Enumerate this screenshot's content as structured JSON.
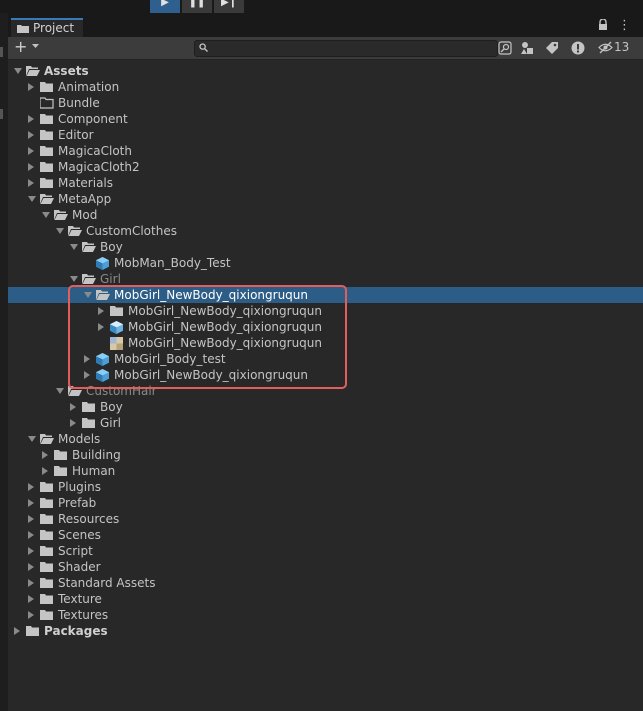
{
  "toolbar_top": {
    "play_icon": "play-icon",
    "pause_icon": "pause-icon",
    "step_icon": "step-icon"
  },
  "window": {
    "tab_label": "Project",
    "tab_icon": "folder-icon",
    "hidden_count": "13"
  },
  "tree": [
    {
      "label": "Assets",
      "depth": 0,
      "arrow": "down",
      "icon": "folder-open",
      "bold": true
    },
    {
      "label": "Animation",
      "depth": 1,
      "arrow": "right",
      "icon": "folder"
    },
    {
      "label": "Bundle",
      "depth": 1,
      "arrow": "none",
      "icon": "folder-empty"
    },
    {
      "label": "Component",
      "depth": 1,
      "arrow": "right",
      "icon": "folder"
    },
    {
      "label": "Editor",
      "depth": 1,
      "arrow": "right",
      "icon": "folder"
    },
    {
      "label": "MagicaCloth",
      "depth": 1,
      "arrow": "right",
      "icon": "folder"
    },
    {
      "label": "MagicaCloth2",
      "depth": 1,
      "arrow": "right",
      "icon": "folder"
    },
    {
      "label": "Materials",
      "depth": 1,
      "arrow": "right",
      "icon": "folder"
    },
    {
      "label": "MetaApp",
      "depth": 1,
      "arrow": "down",
      "icon": "folder-open"
    },
    {
      "label": "Mod",
      "depth": 2,
      "arrow": "down",
      "icon": "folder-open"
    },
    {
      "label": "CustomClothes",
      "depth": 3,
      "arrow": "down",
      "icon": "folder-open"
    },
    {
      "label": "Boy",
      "depth": 4,
      "arrow": "down",
      "icon": "folder-open"
    },
    {
      "label": "MobMan_Body_Test",
      "depth": 5,
      "arrow": "none",
      "icon": "prefab"
    },
    {
      "label": "Girl",
      "depth": 4,
      "arrow": "down",
      "icon": "folder-open",
      "dim": true
    },
    {
      "label": "MobGirl_NewBody_qixiongruqun",
      "depth": 5,
      "arrow": "down",
      "icon": "folder-open",
      "selected": true
    },
    {
      "label": "MobGirl_NewBody_qixiongruqun",
      "depth": 6,
      "arrow": "right",
      "icon": "folder"
    },
    {
      "label": "MobGirl_NewBody_qixiongruqun",
      "depth": 6,
      "arrow": "right",
      "icon": "model"
    },
    {
      "label": "MobGirl_NewBody_qixiongruqun",
      "depth": 6,
      "arrow": "none",
      "icon": "texture"
    },
    {
      "label": "MobGirl_Body_test",
      "depth": 5,
      "arrow": "right",
      "icon": "prefab"
    },
    {
      "label": "MobGirl_NewBody_qixiongruqun",
      "depth": 5,
      "arrow": "right",
      "icon": "prefab"
    },
    {
      "label": "CustomHair",
      "depth": 3,
      "arrow": "down",
      "icon": "folder-open",
      "dim": true
    },
    {
      "label": "Boy",
      "depth": 4,
      "arrow": "right",
      "icon": "folder"
    },
    {
      "label": "Girl",
      "depth": 4,
      "arrow": "right",
      "icon": "folder"
    },
    {
      "label": "Models",
      "depth": 1,
      "arrow": "down",
      "icon": "folder-open"
    },
    {
      "label": "Building",
      "depth": 2,
      "arrow": "right",
      "icon": "folder"
    },
    {
      "label": "Human",
      "depth": 2,
      "arrow": "right",
      "icon": "folder"
    },
    {
      "label": "Plugins",
      "depth": 1,
      "arrow": "right",
      "icon": "folder"
    },
    {
      "label": "Prefab",
      "depth": 1,
      "arrow": "right",
      "icon": "folder"
    },
    {
      "label": "Resources",
      "depth": 1,
      "arrow": "right",
      "icon": "folder"
    },
    {
      "label": "Scenes",
      "depth": 1,
      "arrow": "right",
      "icon": "folder"
    },
    {
      "label": "Script",
      "depth": 1,
      "arrow": "right",
      "icon": "folder"
    },
    {
      "label": "Shader",
      "depth": 1,
      "arrow": "right",
      "icon": "folder"
    },
    {
      "label": "Standard Assets",
      "depth": 1,
      "arrow": "right",
      "icon": "folder"
    },
    {
      "label": "Texture",
      "depth": 1,
      "arrow": "right",
      "icon": "folder"
    },
    {
      "label": "Textures",
      "depth": 1,
      "arrow": "right",
      "icon": "folder"
    },
    {
      "label": "Packages",
      "depth": 0,
      "arrow": "right",
      "icon": "folder",
      "bold": true
    }
  ]
}
